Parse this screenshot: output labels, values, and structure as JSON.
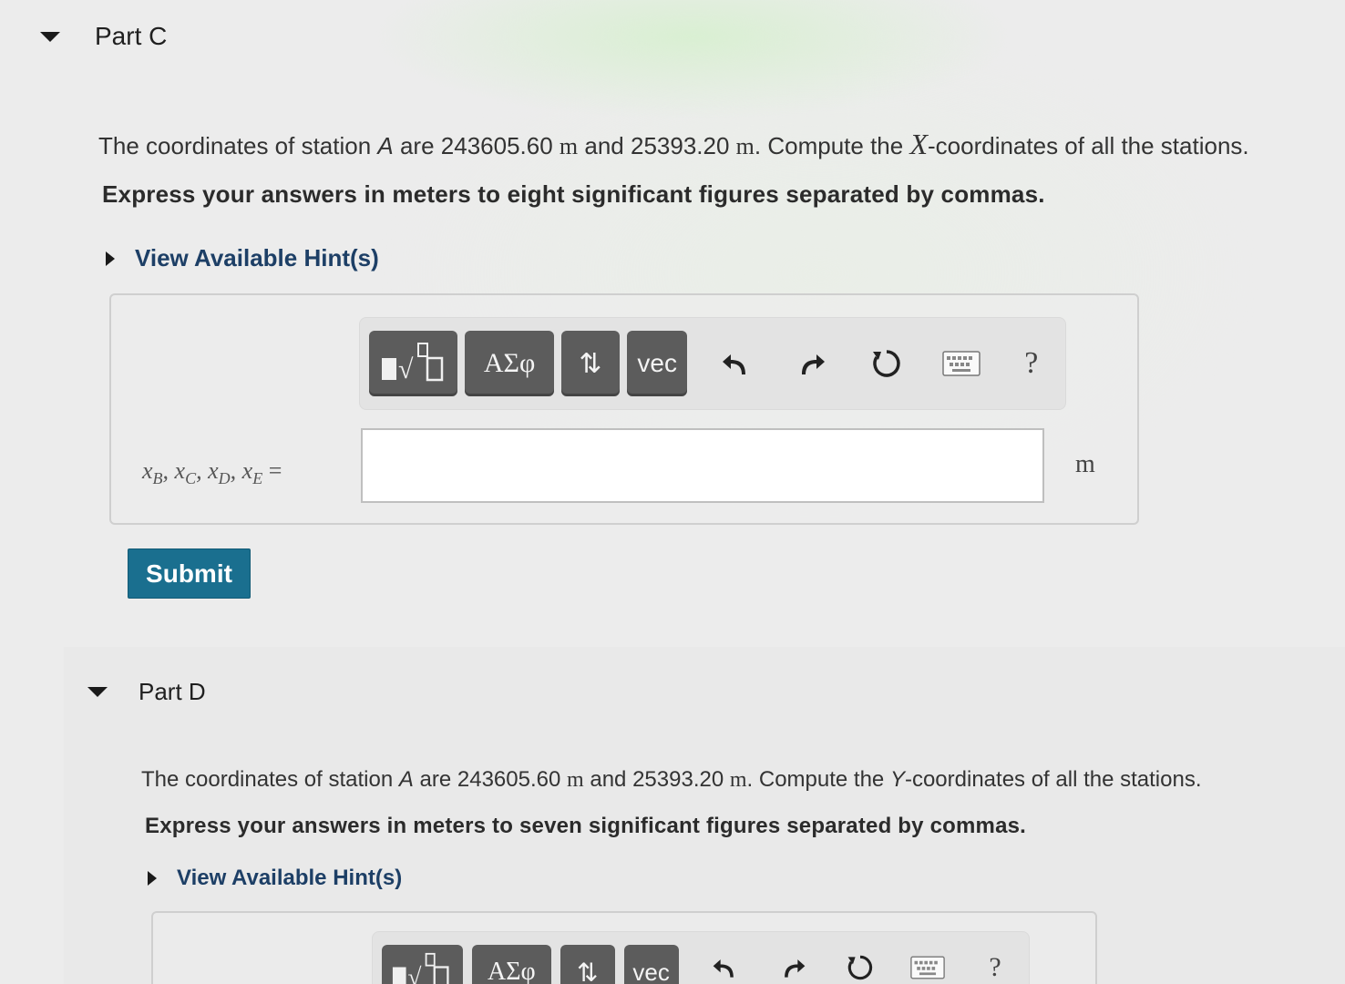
{
  "part_c": {
    "title": "Part C",
    "prompt_start": "The coordinates of station ",
    "station": "A",
    "prompt_are": " are ",
    "coord1": "243605.60",
    "unit_m": "m",
    "prompt_and": " and ",
    "coord2": "25393.20",
    "prompt_compute": ". Compute the ",
    "axis": "X",
    "prompt_end": "-coordinates of all the stations.",
    "instruction": "Express your answers in meters to eight significant figures separated by commas.",
    "hint_label": "View Available Hint(s)",
    "toolbar": {
      "templates_label": "▮√□",
      "greek_label": "ΑΣφ",
      "arrows_label": "⇅",
      "vec_label": "vec",
      "help_label": "?"
    },
    "answer_label": {
      "x": "x",
      "subs": [
        "B",
        "C",
        "D",
        "E"
      ],
      "equals": "="
    },
    "answer_value": "",
    "answer_unit": "m",
    "submit_label": "Submit"
  },
  "part_d": {
    "title": "Part D",
    "prompt_start": "The coordinates of station ",
    "station": "A",
    "prompt_are": " are ",
    "coord1": "243605.60",
    "unit_m": "m",
    "prompt_and": " and ",
    "coord2": "25393.20",
    "prompt_compute": ". Compute the ",
    "axis": "Y",
    "prompt_end": "-coordinates of all the stations.",
    "instruction": "Express your answers in meters to seven significant figures separated by commas.",
    "hint_label": "View Available Hint(s)",
    "toolbar": {
      "templates_label": "▮√□",
      "greek_label": "ΑΣφ",
      "arrows_label": "⇅",
      "vec_label": "vec",
      "help_label": "?"
    }
  },
  "icons": [
    "caret-down-icon",
    "caret-right-icon",
    "undo-icon",
    "redo-icon",
    "reset-icon",
    "keyboard-icon",
    "help-icon"
  ],
  "colors": {
    "submit": "#1a6f8f",
    "hint": "#1d3f66",
    "toolbar_button": "#5c5c5c"
  }
}
